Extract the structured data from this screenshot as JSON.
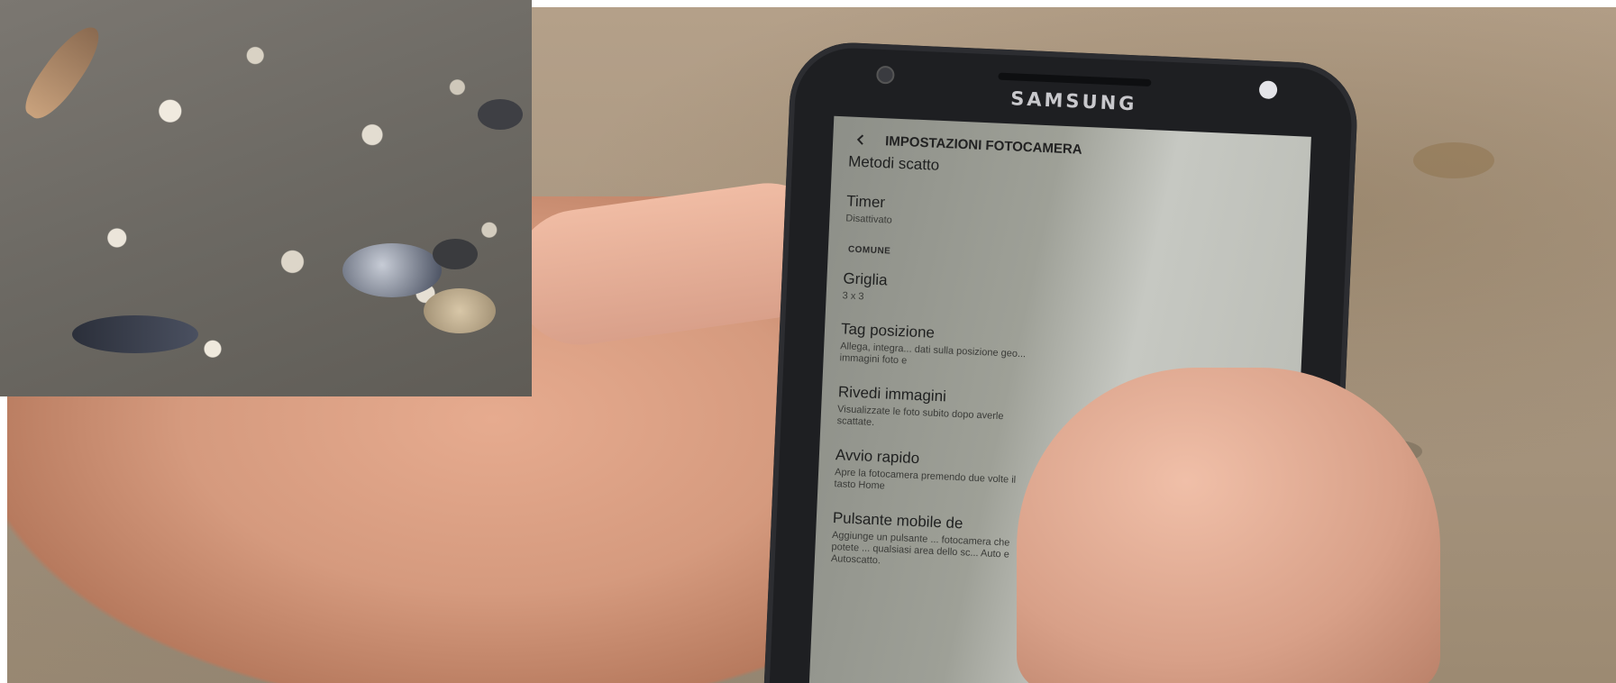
{
  "phone": {
    "brand": "SAMSUNG"
  },
  "screen": {
    "title": "IMPOSTAZIONI FOTOCAMERA",
    "items": [
      {
        "title": "Metodi scatto",
        "subtitle": ""
      },
      {
        "title": "Timer",
        "subtitle": "Disattivato"
      },
      {
        "title": "Griglia",
        "subtitle": "3 x 3"
      },
      {
        "title": "Tag posizione",
        "subtitle": "Allega, integra... dati sulla posizione geo... immagini foto e"
      },
      {
        "title": "Rivedi immagini",
        "subtitle": "Visualizzate le foto subito dopo averle scattate."
      },
      {
        "title": "Avvio rapido",
        "subtitle": "Apre la fotocamera premendo due volte il tasto Home"
      },
      {
        "title": "Pulsante mobile de",
        "subtitle": "Aggiunge un pulsante ... fotocamera che potete ... qualsiasi area dello sc... Auto e Autoscatto."
      }
    ],
    "section_label": "COMUNE"
  }
}
